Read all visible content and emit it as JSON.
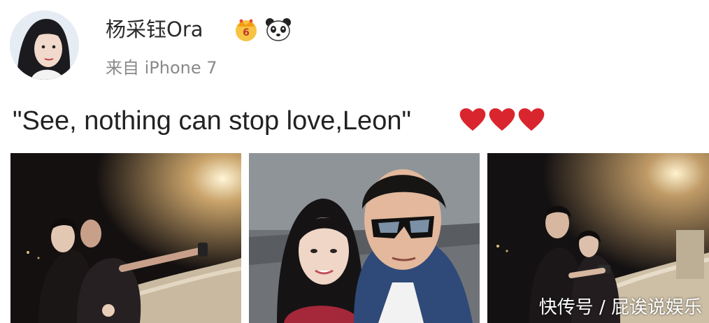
{
  "post": {
    "author": "杨采钰Ora",
    "source": "来自 iPhone 7",
    "text": "\"See, nothing can stop love,Leon\"",
    "emoji_icons": [
      "heart-icon",
      "heart-icon",
      "heart-icon"
    ]
  },
  "badges": [
    "crown-vip-icon",
    "panda-icon"
  ],
  "photos": [
    "night-balcony-selfie-photo",
    "couple-selfie-photo",
    "night-balcony-phone-photo"
  ],
  "watermark": "快传号 / 屁诶说娱乐",
  "colors": {
    "heart": "#d9262e",
    "name": "#2b2b2b",
    "source": "#8a8a8a"
  }
}
